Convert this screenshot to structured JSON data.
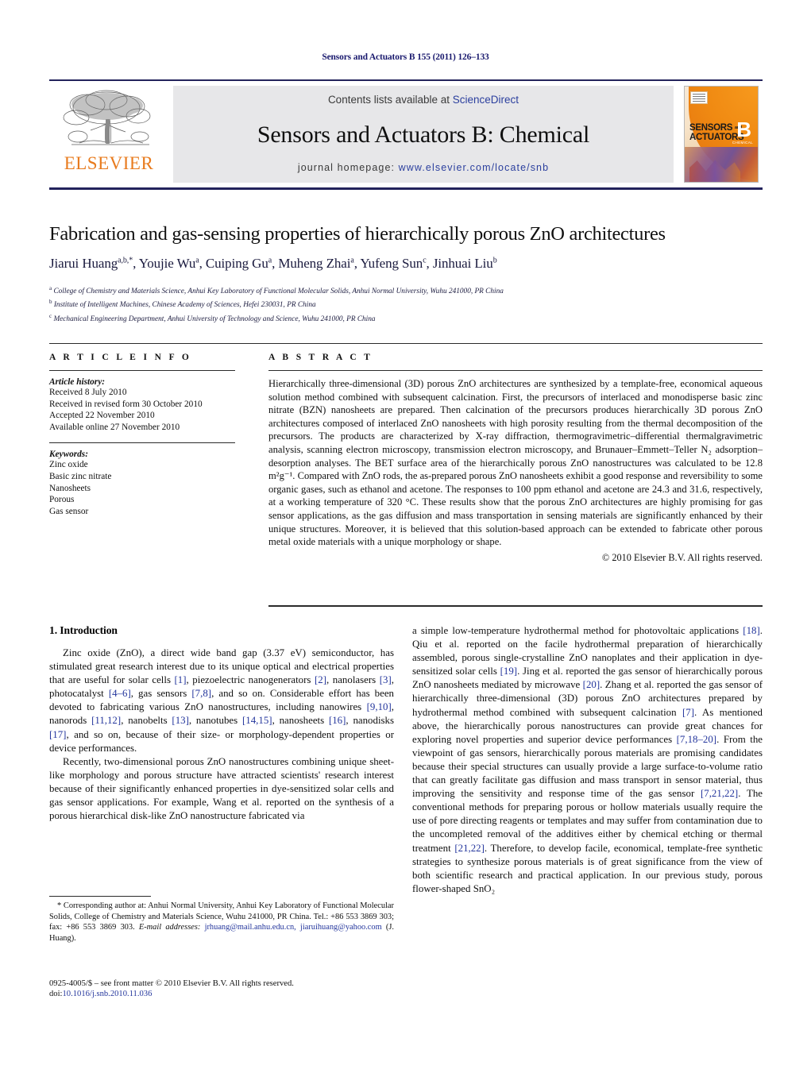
{
  "running_head": "Sensors and Actuators B 155 (2011) 126–133",
  "masthead": {
    "contents_prefix": "Contents lists available at ",
    "sciencedirect": "ScienceDirect",
    "journal_title": "Sensors and Actuators B: Chemical",
    "homepage_prefix": "journal homepage: ",
    "homepage_url": "www.elsevier.com/locate/snb",
    "publisher_wordmark": "ELSEVIER",
    "cover": {
      "line1": "SENSORS",
      "and": "and",
      "line2": "ACTUATORS",
      "letter": "B",
      "sub": "CHEMICAL"
    },
    "colors": {
      "rule": "#23235c",
      "panel_bg": "#e7e7e9",
      "link": "#2b3f9e",
      "elsevier_orange": "#e87b1e"
    }
  },
  "article": {
    "title": "Fabrication and gas-sensing properties of hierarchically porous ZnO architectures",
    "authors": [
      {
        "name": "Jiarui Huang",
        "sup": "a,b,*"
      },
      {
        "name": "Youjie Wu",
        "sup": "a"
      },
      {
        "name": "Cuiping Gu",
        "sup": "a"
      },
      {
        "name": "Muheng Zhai",
        "sup": "a"
      },
      {
        "name": "Yufeng Sun",
        "sup": "c"
      },
      {
        "name": "Jinhuai Liu",
        "sup": "b"
      }
    ],
    "affiliations": [
      {
        "mark": "a",
        "text": "College of Chemistry and Materials Science, Anhui Key Laboratory of Functional Molecular Solids, Anhui Normal University, Wuhu 241000, PR China"
      },
      {
        "mark": "b",
        "text": "Institute of Intelligent Machines, Chinese Academy of Sciences, Hefei 230031, PR China"
      },
      {
        "mark": "c",
        "text": "Mechanical Engineering Department, Anhui University of Technology and Science, Wuhu 241000, PR China"
      }
    ]
  },
  "article_info": {
    "heading": "A R T I C L E   I N F O",
    "history_heading": "Article history:",
    "history": [
      "Received 8 July 2010",
      "Received in revised form 30 October 2010",
      "Accepted 22 November 2010",
      "Available online 27 November 2010"
    ],
    "keywords_heading": "Keywords:",
    "keywords": [
      "Zinc oxide",
      "Basic zinc nitrate",
      "Nanosheets",
      "Porous",
      "Gas sensor"
    ]
  },
  "abstract": {
    "heading": "A B S T R A C T",
    "text": "Hierarchically three-dimensional (3D) porous ZnO architectures are synthesized by a template-free, economical aqueous solution method combined with subsequent calcination. First, the precursors of interlaced and monodisperse basic zinc nitrate (BZN) nanosheets are prepared. Then calcination of the precursors produces hierarchically 3D porous ZnO architectures composed of interlaced ZnO nanosheets with high porosity resulting from the thermal decomposition of the precursors. The products are characterized by X-ray diffraction, thermogravimetric–differential thermalgravimetric analysis, scanning electron microscopy, transmission electron microscopy, and Brunauer–Emmett–Teller N₂ adsorption–desorption analyses. The BET surface area of the hierarchically porous ZnO nanostructures was calculated to be 12.8 m²g⁻¹. Compared with ZnO rods, the as-prepared porous ZnO nanosheets exhibit a good response and reversibility to some organic gases, such as ethanol and acetone. The responses to 100 ppm ethanol and acetone are 24.3 and 31.6, respectively, at a working temperature of 320 °C. These results show that the porous ZnO architectures are highly promising for gas sensor applications, as the gas diffusion and mass transportation in sensing materials are significantly enhanced by their unique structures. Moreover, it is believed that this solution-based approach can be extended to fabricate other porous metal oxide materials with a unique morphology or shape.",
    "copyright": "© 2010 Elsevier B.V. All rights reserved."
  },
  "body": {
    "section_heading": "1.  Introduction",
    "left_par1": "Zinc oxide (ZnO), a direct wide band gap (3.37 eV) semiconductor, has stimulated great research interest due to its unique optical and electrical properties that are useful for solar cells [1], piezoelectric nanogenerators [2], nanolasers [3], photocatalyst [4–6], gas sensors [7,8], and so on. Considerable effort has been devoted to fabricating various ZnO nanostructures, including nanowires [9,10], nanorods [11,12], nanobelts [13], nanotubes [14,15], nanosheets [16], nanodisks [17], and so on, because of their size- or morphology-dependent properties or device performances.",
    "left_par2": "Recently, two-dimensional porous ZnO nanostructures combining unique sheet-like morphology and porous structure have attracted scientists' research interest because of their significantly enhanced properties in dye-sensitized solar cells and gas sensor applications. For example, Wang et al. reported on the synthesis of a porous hierarchical disk-like ZnO nanostructure fabricated via",
    "right_par1": "a simple low-temperature hydrothermal method for photovoltaic applications [18]. Qiu et al. reported on the facile hydrothermal preparation of hierarchically assembled, porous single-crystalline ZnO nanoplates and their application in dye-sensitized solar cells [19]. Jing et al. reported the gas sensor of hierarchically porous ZnO nanosheets mediated by microwave [20]. Zhang et al. reported the gas sensor of hierarchically three-dimensional (3D) porous ZnO architectures prepared by hydrothermal method combined with subsequent calcination [7]. As mentioned above, the hierarchically porous nanostructures can provide great chances for exploring novel properties and superior device performances [7,18–20]. From the viewpoint of gas sensors, hierarchically porous materials are promising candidates because their special structures can usually provide a large surface-to-volume ratio that can greatly facilitate gas diffusion and mass transport in sensor material, thus improving the sensitivity and response time of the gas sensor [7,21,22]. The conventional methods for preparing porous or hollow materials usually require the use of pore directing reagents or templates and may suffer from contamination due to the uncompleted removal of the additives either by chemical etching or thermal treatment [21,22]. Therefore, to develop facile, economical, template-free synthetic strategies to synthesize porous materials is of great significance from the view of both scientific research and practical application. In our previous study, porous flower-shaped SnO₂"
  },
  "footnote": {
    "corresponding": "* Corresponding author at: Anhui Normal University, Anhui Key Laboratory of Functional Molecular Solids, College of Chemistry and Materials Science, Wuhu 241000, PR China. Tel.: +86 553 3869 303; fax: +86 553 3869 303.",
    "email_label": "E-mail addresses:",
    "emails": "jrhuang@mail.anhu.edu.cn, jiaruihuang@yahoo.com",
    "email_owner": "(J. Huang)."
  },
  "imprint": {
    "issn_line": "0925-4005/$ – see front matter © 2010 Elsevier B.V. All rights reserved.",
    "doi_label": "doi:",
    "doi_value": "10.1016/j.snb.2010.11.036"
  }
}
